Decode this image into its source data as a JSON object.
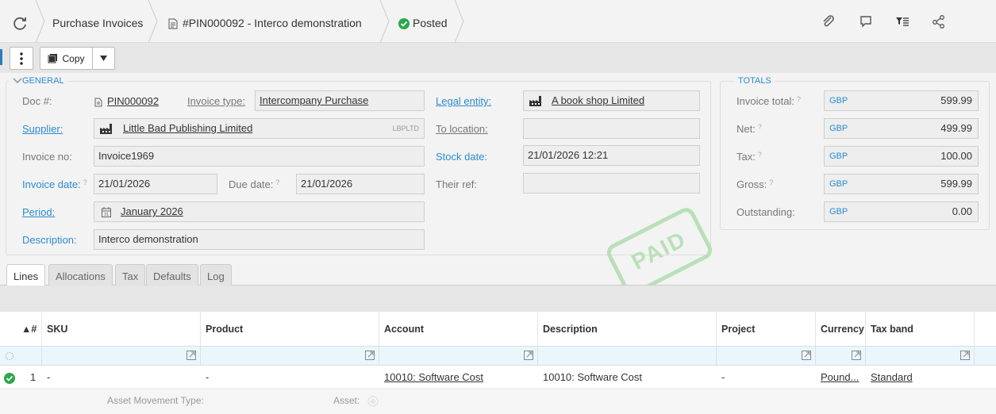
{
  "header": {
    "breadcrumb_1": "Purchase Invoices",
    "breadcrumb_2": "#PIN000092 - Interco demonstration",
    "status": "Posted",
    "icons": [
      "attachment-icon",
      "comment-icon",
      "filter-list-icon",
      "share-icon"
    ]
  },
  "toolbar": {
    "copy_label": "Copy"
  },
  "general": {
    "legend": "GENERAL",
    "doc_label": "Doc #:",
    "doc_value": "PIN000092",
    "invoice_type_label": "Invoice type:",
    "invoice_type_value": "Intercompany Purchase",
    "supplier_label": "Supplier:",
    "supplier_value": "Little Bad Publishing Limited",
    "supplier_code": "LBPLTD",
    "invoice_no_label": "Invoice no:",
    "invoice_no_value": "Invoice1969",
    "invoice_date_label": "Invoice date:",
    "invoice_date_value": "21/01/2026",
    "due_date_label": "Due date:",
    "due_date_value": "21/01/2026",
    "period_label": "Period:",
    "period_value": "January 2026",
    "description_label": "Description:",
    "description_value": "Interco demonstration",
    "legal_entity_label": "Legal entity:",
    "legal_entity_value": "A book shop Limited",
    "to_location_label": "To location:",
    "to_location_value": "",
    "stock_date_label": "Stock date:",
    "stock_date_value": "21/01/2026 12:21",
    "their_ref_label": "Their ref:",
    "their_ref_value": "",
    "help_mark": "?"
  },
  "totals": {
    "legend": "TOTALS",
    "currency": "GBP",
    "rows": [
      {
        "label": "Invoice total:",
        "value": "599.99"
      },
      {
        "label": "Net:",
        "value": "499.99"
      },
      {
        "label": "Tax:",
        "value": "100.00"
      },
      {
        "label": "Gross:",
        "value": "599.99"
      },
      {
        "label": "Outstanding:",
        "value": "0.00"
      }
    ]
  },
  "stamp": "PAID",
  "tabs": [
    "Lines",
    "Allocations",
    "Tax",
    "Defaults",
    "Log"
  ],
  "grid": {
    "columns": [
      "▲#",
      "SKU",
      "Product",
      "Account",
      "Description",
      "Project",
      "Currency",
      "Tax band"
    ],
    "row": {
      "num": "1",
      "sku": "-",
      "product": "-",
      "account": "10010: Software Cost",
      "description": "10010: Software Cost",
      "project": "-",
      "currency": "Pound...",
      "tax_band": "Standard"
    },
    "sub_labels": {
      "asset_movement_type": "Asset Movement Type:",
      "asset": "Asset:"
    }
  }
}
